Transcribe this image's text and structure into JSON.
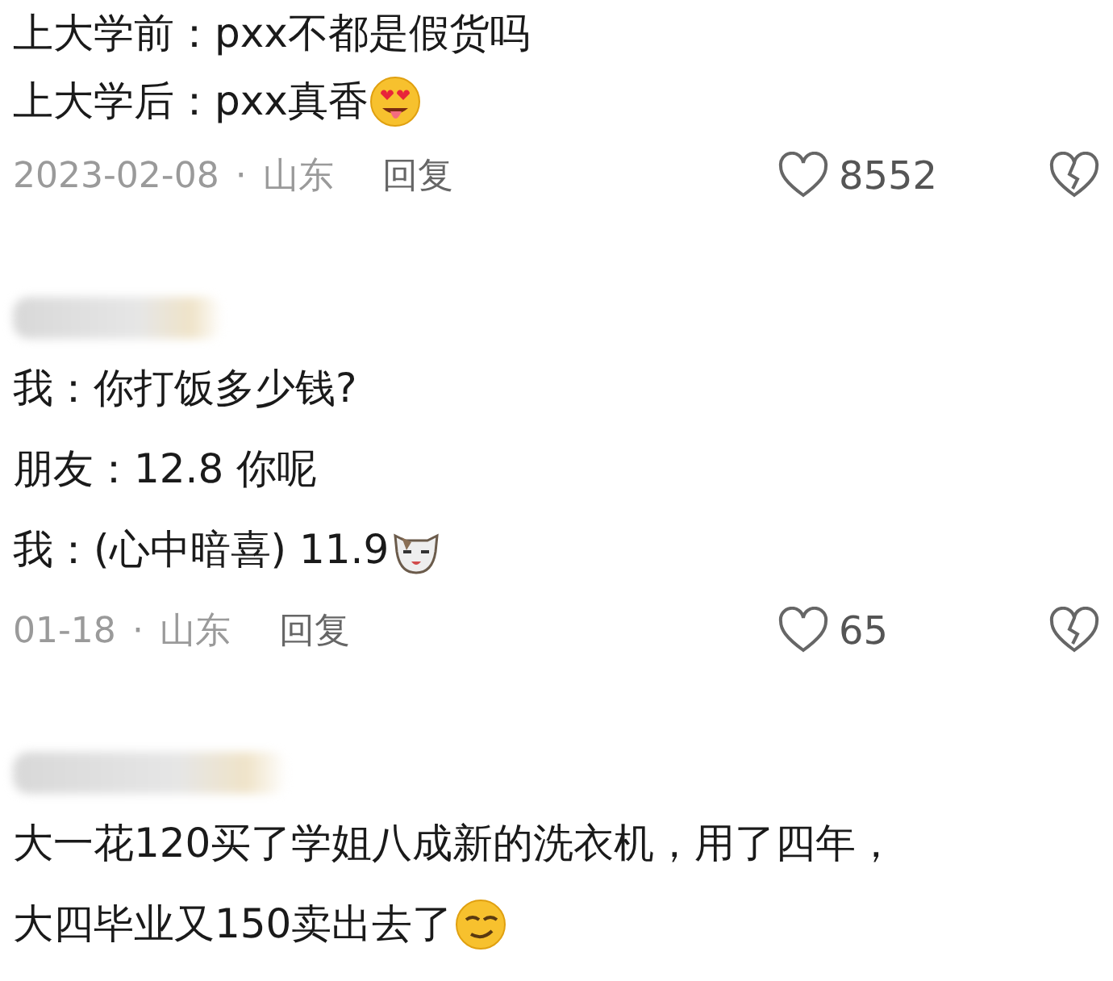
{
  "comments": [
    {
      "name_blurred": false,
      "lines": [
        {
          "text": "上大学前：pxx不都是假货吗",
          "kind": "plain"
        },
        {
          "text": "上大学后：pxx真香",
          "kind": "heart-eyes"
        }
      ],
      "meta": {
        "date": "2023-02-08",
        "separator": "·",
        "location": "山东",
        "reply": "回复",
        "likes": "8552",
        "liked": false
      }
    },
    {
      "name_blurred": true,
      "lines": [
        {
          "text": "我：你打饭多少钱?",
          "kind": "plain"
        },
        {
          "text": "朋友：12.8 你呢",
          "kind": "plain"
        },
        {
          "text": "我：(心中暗喜) 11.9",
          "kind": "cat"
        }
      ],
      "meta": {
        "date": "01-18",
        "separator": "·",
        "location": "山东",
        "reply": "回复",
        "likes": "65",
        "liked": false
      }
    },
    {
      "name_blurred": true,
      "lines": [
        {
          "text": "大一花120买了学姐八成新的洗衣机，用了四年，",
          "kind": "plain"
        },
        {
          "text": "大四毕业又150卖出去了",
          "kind": "sly"
        }
      ]
    }
  ]
}
